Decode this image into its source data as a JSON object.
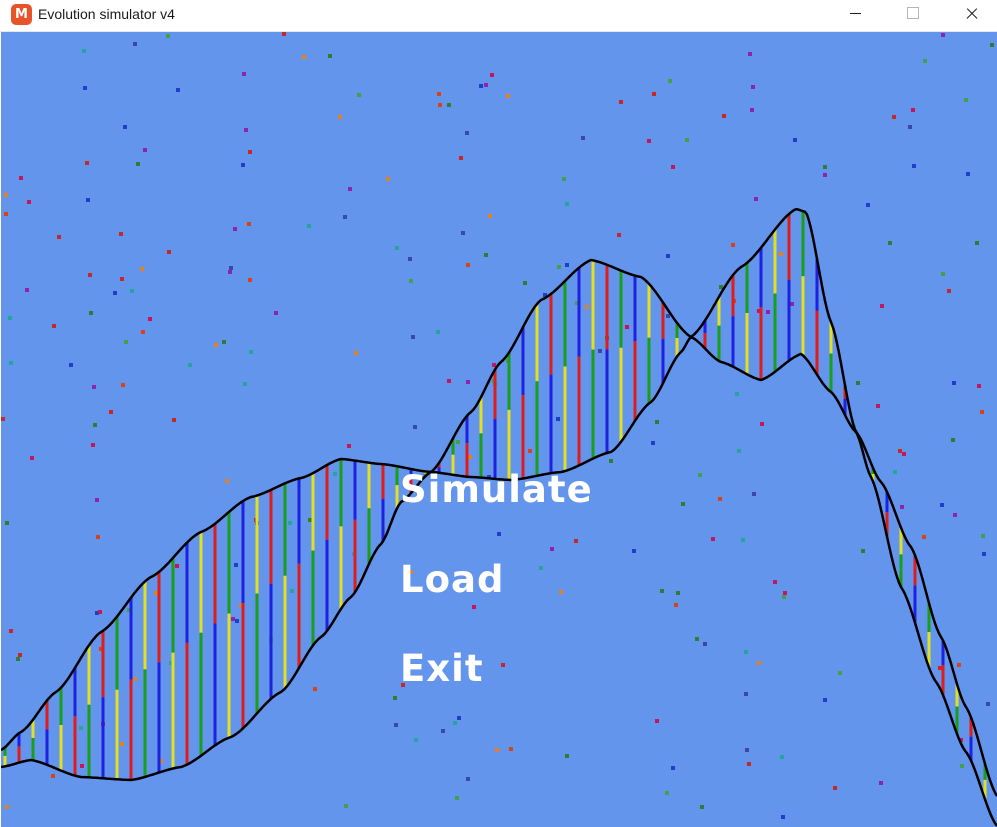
{
  "window": {
    "title": "Evolution simulator v4",
    "icon": "monogame-icon",
    "controls": [
      "minimize-icon",
      "maximize-icon",
      "close-icon"
    ]
  },
  "scene": {
    "background_color": "#6495ed",
    "stripe_colors": [
      "#1a9e1a",
      "#2020e0",
      "#e0e020",
      "#e01c1c"
    ],
    "outline_color": "#000000"
  },
  "menu": {
    "simulate": "Simulate",
    "load": "Load",
    "exit": "Exit"
  }
}
